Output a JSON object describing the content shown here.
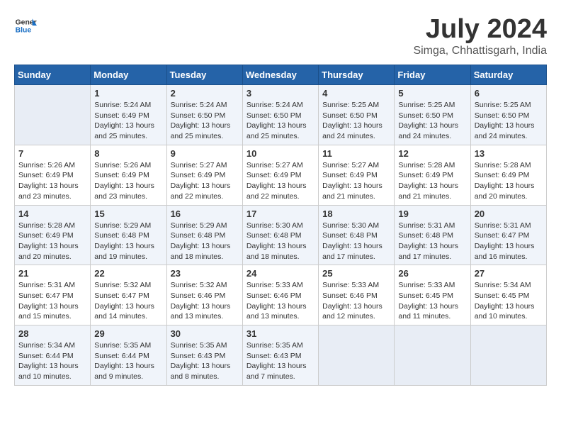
{
  "header": {
    "logo_line1": "General",
    "logo_line2": "Blue",
    "month_year": "July 2024",
    "location": "Simga, Chhattisgarh, India"
  },
  "weekdays": [
    "Sunday",
    "Monday",
    "Tuesday",
    "Wednesday",
    "Thursday",
    "Friday",
    "Saturday"
  ],
  "weeks": [
    [
      {
        "day": "",
        "info": ""
      },
      {
        "day": "1",
        "info": "Sunrise: 5:24 AM\nSunset: 6:49 PM\nDaylight: 13 hours\nand 25 minutes."
      },
      {
        "day": "2",
        "info": "Sunrise: 5:24 AM\nSunset: 6:50 PM\nDaylight: 13 hours\nand 25 minutes."
      },
      {
        "day": "3",
        "info": "Sunrise: 5:24 AM\nSunset: 6:50 PM\nDaylight: 13 hours\nand 25 minutes."
      },
      {
        "day": "4",
        "info": "Sunrise: 5:25 AM\nSunset: 6:50 PM\nDaylight: 13 hours\nand 24 minutes."
      },
      {
        "day": "5",
        "info": "Sunrise: 5:25 AM\nSunset: 6:50 PM\nDaylight: 13 hours\nand 24 minutes."
      },
      {
        "day": "6",
        "info": "Sunrise: 5:25 AM\nSunset: 6:50 PM\nDaylight: 13 hours\nand 24 minutes."
      }
    ],
    [
      {
        "day": "7",
        "info": "Sunrise: 5:26 AM\nSunset: 6:49 PM\nDaylight: 13 hours\nand 23 minutes."
      },
      {
        "day": "8",
        "info": "Sunrise: 5:26 AM\nSunset: 6:49 PM\nDaylight: 13 hours\nand 23 minutes."
      },
      {
        "day": "9",
        "info": "Sunrise: 5:27 AM\nSunset: 6:49 PM\nDaylight: 13 hours\nand 22 minutes."
      },
      {
        "day": "10",
        "info": "Sunrise: 5:27 AM\nSunset: 6:49 PM\nDaylight: 13 hours\nand 22 minutes."
      },
      {
        "day": "11",
        "info": "Sunrise: 5:27 AM\nSunset: 6:49 PM\nDaylight: 13 hours\nand 21 minutes."
      },
      {
        "day": "12",
        "info": "Sunrise: 5:28 AM\nSunset: 6:49 PM\nDaylight: 13 hours\nand 21 minutes."
      },
      {
        "day": "13",
        "info": "Sunrise: 5:28 AM\nSunset: 6:49 PM\nDaylight: 13 hours\nand 20 minutes."
      }
    ],
    [
      {
        "day": "14",
        "info": "Sunrise: 5:28 AM\nSunset: 6:49 PM\nDaylight: 13 hours\nand 20 minutes."
      },
      {
        "day": "15",
        "info": "Sunrise: 5:29 AM\nSunset: 6:48 PM\nDaylight: 13 hours\nand 19 minutes."
      },
      {
        "day": "16",
        "info": "Sunrise: 5:29 AM\nSunset: 6:48 PM\nDaylight: 13 hours\nand 18 minutes."
      },
      {
        "day": "17",
        "info": "Sunrise: 5:30 AM\nSunset: 6:48 PM\nDaylight: 13 hours\nand 18 minutes."
      },
      {
        "day": "18",
        "info": "Sunrise: 5:30 AM\nSunset: 6:48 PM\nDaylight: 13 hours\nand 17 minutes."
      },
      {
        "day": "19",
        "info": "Sunrise: 5:31 AM\nSunset: 6:48 PM\nDaylight: 13 hours\nand 17 minutes."
      },
      {
        "day": "20",
        "info": "Sunrise: 5:31 AM\nSunset: 6:47 PM\nDaylight: 13 hours\nand 16 minutes."
      }
    ],
    [
      {
        "day": "21",
        "info": "Sunrise: 5:31 AM\nSunset: 6:47 PM\nDaylight: 13 hours\nand 15 minutes."
      },
      {
        "day": "22",
        "info": "Sunrise: 5:32 AM\nSunset: 6:47 PM\nDaylight: 13 hours\nand 14 minutes."
      },
      {
        "day": "23",
        "info": "Sunrise: 5:32 AM\nSunset: 6:46 PM\nDaylight: 13 hours\nand 13 minutes."
      },
      {
        "day": "24",
        "info": "Sunrise: 5:33 AM\nSunset: 6:46 PM\nDaylight: 13 hours\nand 13 minutes."
      },
      {
        "day": "25",
        "info": "Sunrise: 5:33 AM\nSunset: 6:46 PM\nDaylight: 13 hours\nand 12 minutes."
      },
      {
        "day": "26",
        "info": "Sunrise: 5:33 AM\nSunset: 6:45 PM\nDaylight: 13 hours\nand 11 minutes."
      },
      {
        "day": "27",
        "info": "Sunrise: 5:34 AM\nSunset: 6:45 PM\nDaylight: 13 hours\nand 10 minutes."
      }
    ],
    [
      {
        "day": "28",
        "info": "Sunrise: 5:34 AM\nSunset: 6:44 PM\nDaylight: 13 hours\nand 10 minutes."
      },
      {
        "day": "29",
        "info": "Sunrise: 5:35 AM\nSunset: 6:44 PM\nDaylight: 13 hours\nand 9 minutes."
      },
      {
        "day": "30",
        "info": "Sunrise: 5:35 AM\nSunset: 6:43 PM\nDaylight: 13 hours\nand 8 minutes."
      },
      {
        "day": "31",
        "info": "Sunrise: 5:35 AM\nSunset: 6:43 PM\nDaylight: 13 hours\nand 7 minutes."
      },
      {
        "day": "",
        "info": ""
      },
      {
        "day": "",
        "info": ""
      },
      {
        "day": "",
        "info": ""
      }
    ]
  ]
}
